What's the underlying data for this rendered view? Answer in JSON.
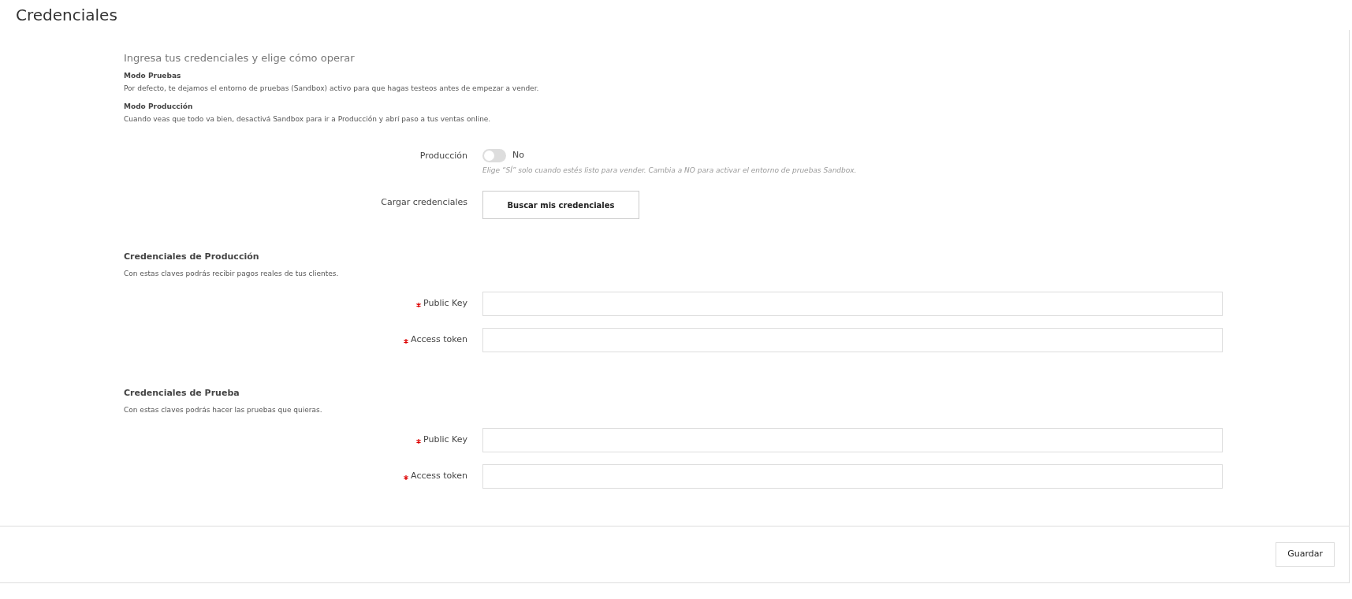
{
  "title": "Credenciales",
  "intro": {
    "heading": "Ingresa tus credenciales y elige cómo operar",
    "modes": [
      {
        "title": "Modo Pruebas",
        "text": "Por defecto, te dejamos el entorno de pruebas (Sandbox) activo para que hagas testeos antes de empezar a vender."
      },
      {
        "title": "Modo Producción",
        "text": "Cuando veas que todo va bien, desactivá Sandbox para ir a Producción y abrí paso a tus ventas online."
      }
    ]
  },
  "production_toggle": {
    "label": "Producción",
    "on": false,
    "value_text": "No",
    "hint": "Elige “SÍ” solo cuando estés listo para vender. Cambia a NO para activar el entorno de pruebas Sandbox."
  },
  "load_credentials": {
    "label": "Cargar credenciales",
    "button": "Buscar mis credenciales"
  },
  "sections": [
    {
      "title": "Credenciales de Producción",
      "description": "Con estas claves podrás recibir pagos reales de tus clientes.",
      "fields": [
        {
          "label": "Public Key",
          "required": true
        },
        {
          "label": "Access token",
          "required": true
        }
      ]
    },
    {
      "title": "Credenciales de Prueba",
      "description": "Con estas claves podrás hacer las pruebas que quieras.",
      "fields": [
        {
          "label": "Public Key",
          "required": true
        },
        {
          "label": "Access token",
          "required": true
        }
      ]
    }
  ],
  "footer": {
    "button": "Guardar"
  }
}
